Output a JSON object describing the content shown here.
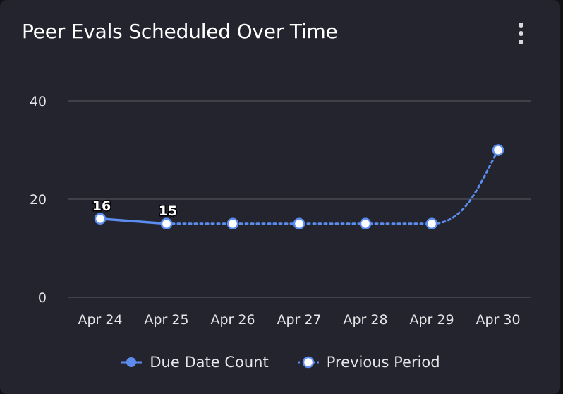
{
  "card": {
    "title": "Peer Evals Scheduled Over Time"
  },
  "icons": {
    "menu": "more-vertical-icon"
  },
  "colors": {
    "card_background": "#24242e",
    "series": "#5b8def",
    "gridline": "#4a4a52",
    "marker_fill": "#ffffff",
    "text": "#e6e6ea"
  },
  "legend_position": "bottom",
  "chart_data": {
    "type": "line",
    "categories": [
      "Apr 24",
      "Apr 25",
      "Apr 26",
      "Apr 27",
      "Apr 28",
      "Apr 29",
      "Apr 30"
    ],
    "ylim": [
      0,
      40
    ],
    "yticks": [
      0,
      20,
      40
    ],
    "grid": true,
    "series": [
      {
        "name": "Due Date Count",
        "style": "solid",
        "values": [
          16,
          15,
          null,
          null,
          null,
          null,
          null
        ],
        "data_labels": [
          "16",
          "15",
          "",
          "",
          "",
          "",
          ""
        ]
      },
      {
        "name": "Previous Period",
        "style": "dotted",
        "values": [
          null,
          15,
          15,
          15,
          15,
          15,
          30
        ]
      }
    ]
  }
}
